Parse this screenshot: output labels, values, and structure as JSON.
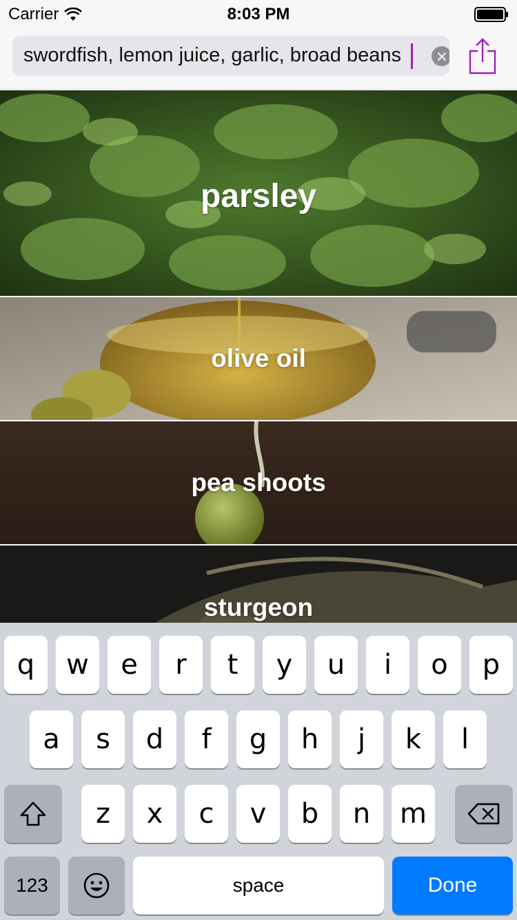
{
  "status_bar": {
    "carrier": "Carrier",
    "time": "8:03 PM"
  },
  "search": {
    "value": "swordfish, lemon juice, garlic, broad beans",
    "accent_color": "#a020c0"
  },
  "ingredients": [
    {
      "label": "parsley",
      "theme": "green leaves"
    },
    {
      "label": "olive oil",
      "theme": "oil bowl"
    },
    {
      "label": "pea shoots",
      "theme": "dark brown"
    },
    {
      "label": "sturgeon",
      "theme": "dark fish"
    }
  ],
  "keyboard": {
    "row1": [
      "q",
      "w",
      "e",
      "r",
      "t",
      "y",
      "u",
      "i",
      "o",
      "p"
    ],
    "row2": [
      "a",
      "s",
      "d",
      "f",
      "g",
      "h",
      "j",
      "k",
      "l"
    ],
    "row3": [
      "z",
      "x",
      "c",
      "v",
      "b",
      "n",
      "m"
    ],
    "numbers_label": "123",
    "space_label": "space",
    "done_label": "Done",
    "shift_icon": "shift-icon",
    "delete_icon": "backspace-icon",
    "emoji_icon": "emoji-icon",
    "done_color": "#007aff"
  }
}
